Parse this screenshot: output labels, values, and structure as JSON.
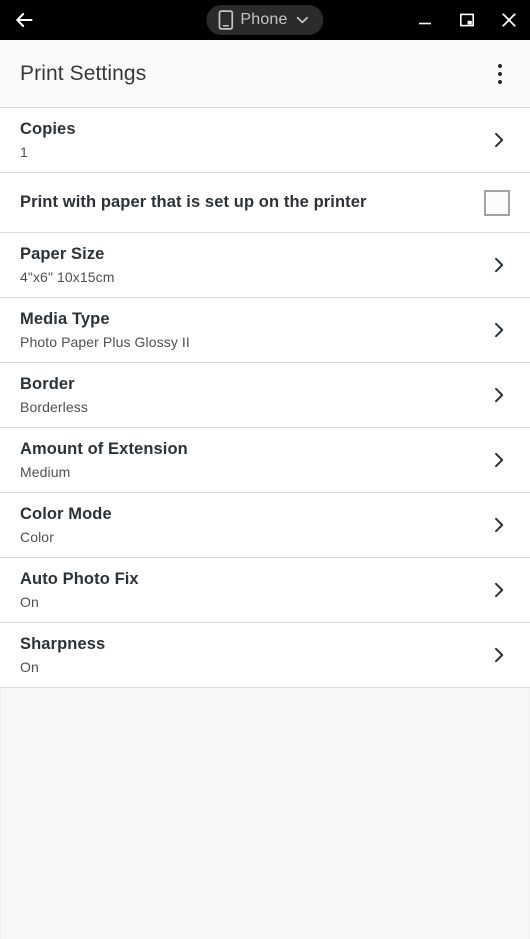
{
  "titlebar": {
    "back_icon": "arrow-left-icon",
    "device_pill": {
      "icon": "phone-icon",
      "label": "Phone",
      "chevron": "chevron-down-icon"
    },
    "window_controls": {
      "minimize": "minimize-icon",
      "restore": "restore-icon",
      "close": "close-icon"
    },
    "background": "#000000"
  },
  "header": {
    "title": "Print Settings",
    "overflow_icon": "more-vertical-icon",
    "background": "#fafafa"
  },
  "settings": [
    {
      "label": "Copies",
      "value": "1",
      "control": "chevron",
      "name": "copies"
    },
    {
      "label": "Print with paper that is set up on the printer",
      "value": "",
      "control": "checkbox",
      "checked": false,
      "name": "print-with-paper-set-up"
    },
    {
      "label": "Paper Size",
      "value": "4\"x6\" 10x15cm",
      "control": "chevron",
      "name": "paper-size"
    },
    {
      "label": "Media Type",
      "value": "Photo Paper Plus Glossy II",
      "control": "chevron",
      "name": "media-type"
    },
    {
      "label": "Border",
      "value": "Borderless",
      "control": "chevron",
      "name": "border"
    },
    {
      "label": "Amount of Extension",
      "value": "Medium",
      "control": "chevron",
      "name": "amount-of-extension"
    },
    {
      "label": "Color Mode",
      "value": "Color",
      "control": "chevron",
      "name": "color-mode"
    },
    {
      "label": "Auto Photo Fix",
      "value": "On",
      "control": "chevron",
      "name": "auto-photo-fix"
    },
    {
      "label": "Sharpness",
      "value": "On",
      "control": "chevron",
      "name": "sharpness"
    }
  ],
  "colors": {
    "titlebar_bg": "#000000",
    "header_bg": "#fafafa",
    "row_bg": "#ffffff",
    "divider": "#dadada",
    "label_text": "#2d3238",
    "value_text": "#4c5055",
    "empty_area_bg": "#f7f7f7",
    "checkbox_border": "#a3a3a3",
    "pill_bg": "#2b2b2b",
    "pill_text": "#c6c6c6"
  }
}
